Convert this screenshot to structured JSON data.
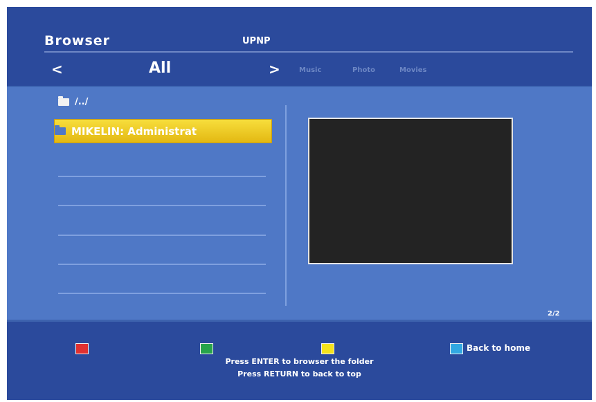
{
  "header": {
    "title": "Browser",
    "source": "UPNP"
  },
  "nav": {
    "prev_icon": "<",
    "current_filter": "All",
    "next_icon": ">",
    "filters": [
      "Music",
      "Photo",
      "Movies"
    ]
  },
  "list": {
    "parent_label": "/../",
    "items": [
      {
        "label": "MIKELIN: Administrat",
        "selected": true
      }
    ]
  },
  "page_indicator": "2/2",
  "footer": {
    "keys": [
      {
        "name": "red",
        "color": "#e03131"
      },
      {
        "name": "green",
        "color": "#27a44a"
      },
      {
        "name": "yellow",
        "color": "#f4e21c"
      },
      {
        "name": "blue",
        "color": "#31a8e2"
      }
    ],
    "back_label": "Back to home",
    "hint_enter": "Press ENTER to browser the folder",
    "hint_return": "Press RETURN to back to top"
  },
  "colors": {
    "background": "#2b4a9c",
    "content": "#4f78c6",
    "highlight": "#f2c921"
  }
}
